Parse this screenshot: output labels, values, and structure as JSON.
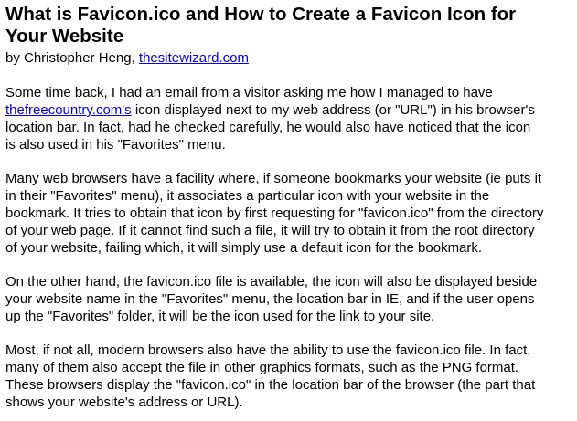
{
  "article": {
    "title_line1": "What is Favicon.ico and How to Create a Favicon Icon for",
    "title_line2": "Your Website",
    "byline_prefix": "by Christopher Heng, ",
    "byline_link": "thesitewizard.com",
    "p1": {
      "l1": "Some time back, I had an email from a visitor asking me how I managed to have",
      "l2_link": "thefreecountry.com's",
      "l2_rest": " icon displayed next to my web address (or \"URL\") in his browser's",
      "l3": "location bar. In fact, had he checked carefully, he would also have noticed that the icon",
      "l4": "is also used in his \"Favorites\" menu."
    },
    "p2": {
      "l1": "Many web browsers have a facility where, if someone bookmarks your website (ie puts it",
      "l2": "in their \"Favorites\" menu), it associates a particular icon with your website in the",
      "l3": "bookmark. It tries to obtain that icon by first requesting for \"favicon.ico\" from the directory",
      "l4": "of your web page. If it cannot find such a file, it will try to obtain it from the root directory",
      "l5": "of your website, failing which, it will simply use a default icon for the bookmark."
    },
    "p3": {
      "l1": "On the other hand, the favicon.ico file is available, the icon will also be displayed beside",
      "l2": "your website name in the \"Favorites\" menu, the location bar in IE, and if the user opens",
      "l3": "up the \"Favorites\" folder, it will be the icon used for the link to your site."
    },
    "p4": {
      "l1": "Most, if not all, modern browsers also have the ability to use the favicon.ico file. In fact,",
      "l2": "many of them also accept the file in other graphics formats, such as the PNG format.",
      "l3": "These browsers display the \"favicon.ico\" in the location bar of the browser (the part that",
      "l4": "shows your website's address or URL)."
    }
  },
  "colors": {
    "link": "#0000ee",
    "text": "#000000",
    "background": "#ffffff"
  }
}
